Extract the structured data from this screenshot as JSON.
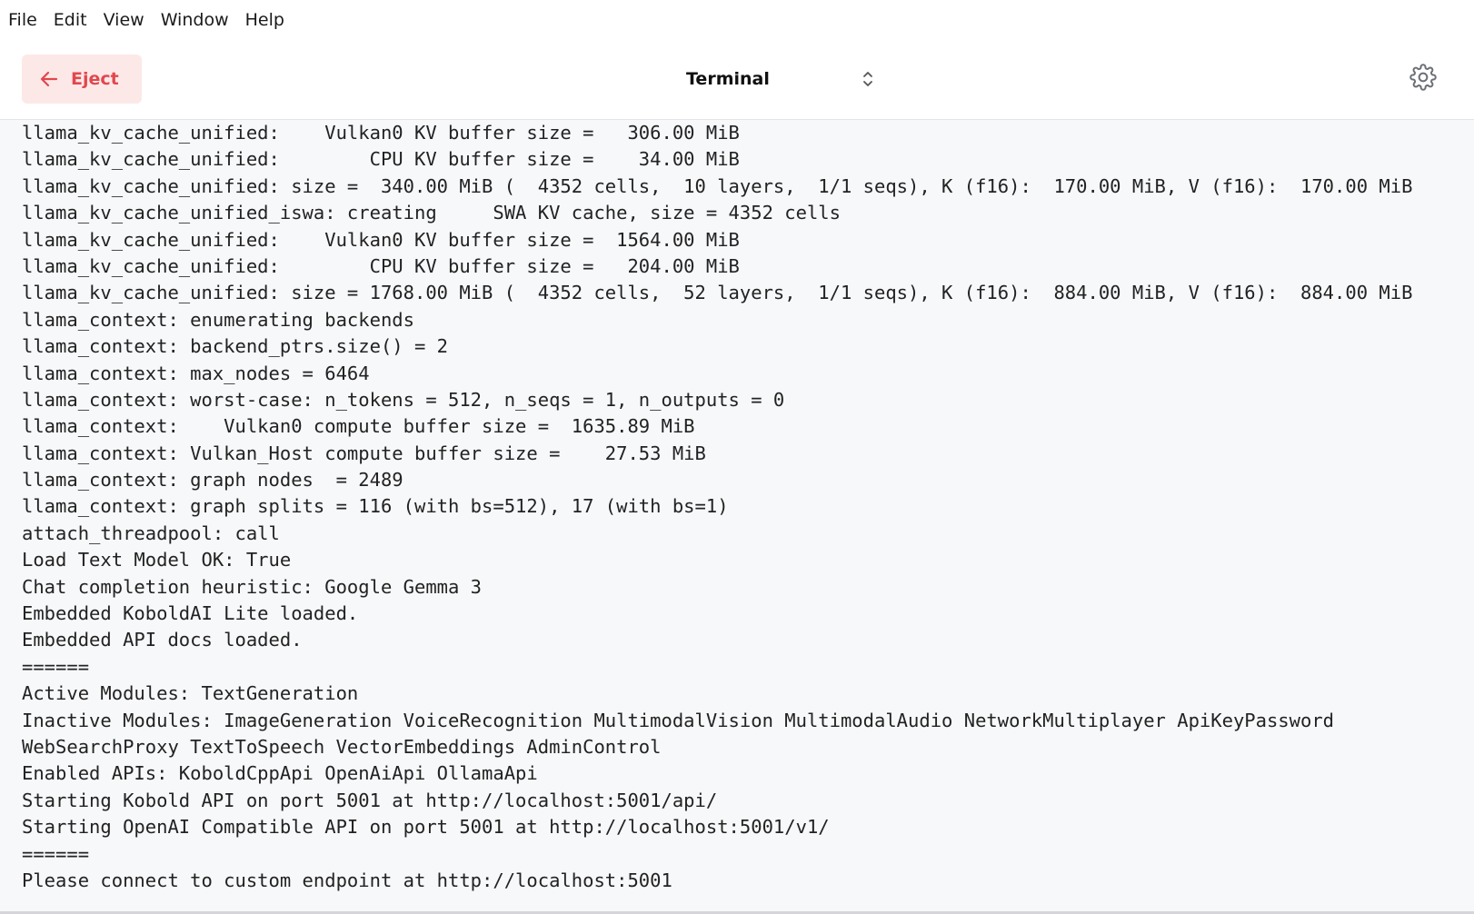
{
  "menubar": {
    "items": [
      "File",
      "Edit",
      "View",
      "Window",
      "Help"
    ]
  },
  "toolbar": {
    "eject_label": "Eject",
    "view_select_value": "Terminal",
    "colors": {
      "eject_bg": "#fde8e8",
      "eject_fg": "#e0484d"
    }
  },
  "terminal": {
    "lines": [
      "llama_kv_cache_unified:    Vulkan0 KV buffer size =   306.00 MiB",
      "llama_kv_cache_unified:        CPU KV buffer size =    34.00 MiB",
      "llama_kv_cache_unified: size =  340.00 MiB (  4352 cells,  10 layers,  1/1 seqs), K (f16):  170.00 MiB, V (f16):  170.00 MiB",
      "llama_kv_cache_unified_iswa: creating     SWA KV cache, size = 4352 cells",
      "llama_kv_cache_unified:    Vulkan0 KV buffer size =  1564.00 MiB",
      "llama_kv_cache_unified:        CPU KV buffer size =   204.00 MiB",
      "llama_kv_cache_unified: size = 1768.00 MiB (  4352 cells,  52 layers,  1/1 seqs), K (f16):  884.00 MiB, V (f16):  884.00 MiB",
      "llama_context: enumerating backends",
      "llama_context: backend_ptrs.size() = 2",
      "llama_context: max_nodes = 6464",
      "llama_context: worst-case: n_tokens = 512, n_seqs = 1, n_outputs = 0",
      "llama_context:    Vulkan0 compute buffer size =  1635.89 MiB",
      "llama_context: Vulkan_Host compute buffer size =    27.53 MiB",
      "llama_context: graph nodes  = 2489",
      "llama_context: graph splits = 116 (with bs=512), 17 (with bs=1)",
      "attach_threadpool: call",
      "Load Text Model OK: True",
      "Chat completion heuristic: Google Gemma 3",
      "Embedded KoboldAI Lite loaded.",
      "Embedded API docs loaded.",
      "======",
      "Active Modules: TextGeneration",
      "Inactive Modules: ImageGeneration VoiceRecognition MultimodalVision MultimodalAudio NetworkMultiplayer ApiKeyPassword",
      "WebSearchProxy TextToSpeech VectorEmbeddings AdminControl",
      "Enabled APIs: KoboldCppApi OpenAiApi OllamaApi",
      "Starting Kobold API on port 5001 at http://localhost:5001/api/",
      "Starting OpenAI Compatible API on port 5001 at http://localhost:5001/v1/",
      "======",
      "Please connect to custom endpoint at http://localhost:5001"
    ]
  }
}
